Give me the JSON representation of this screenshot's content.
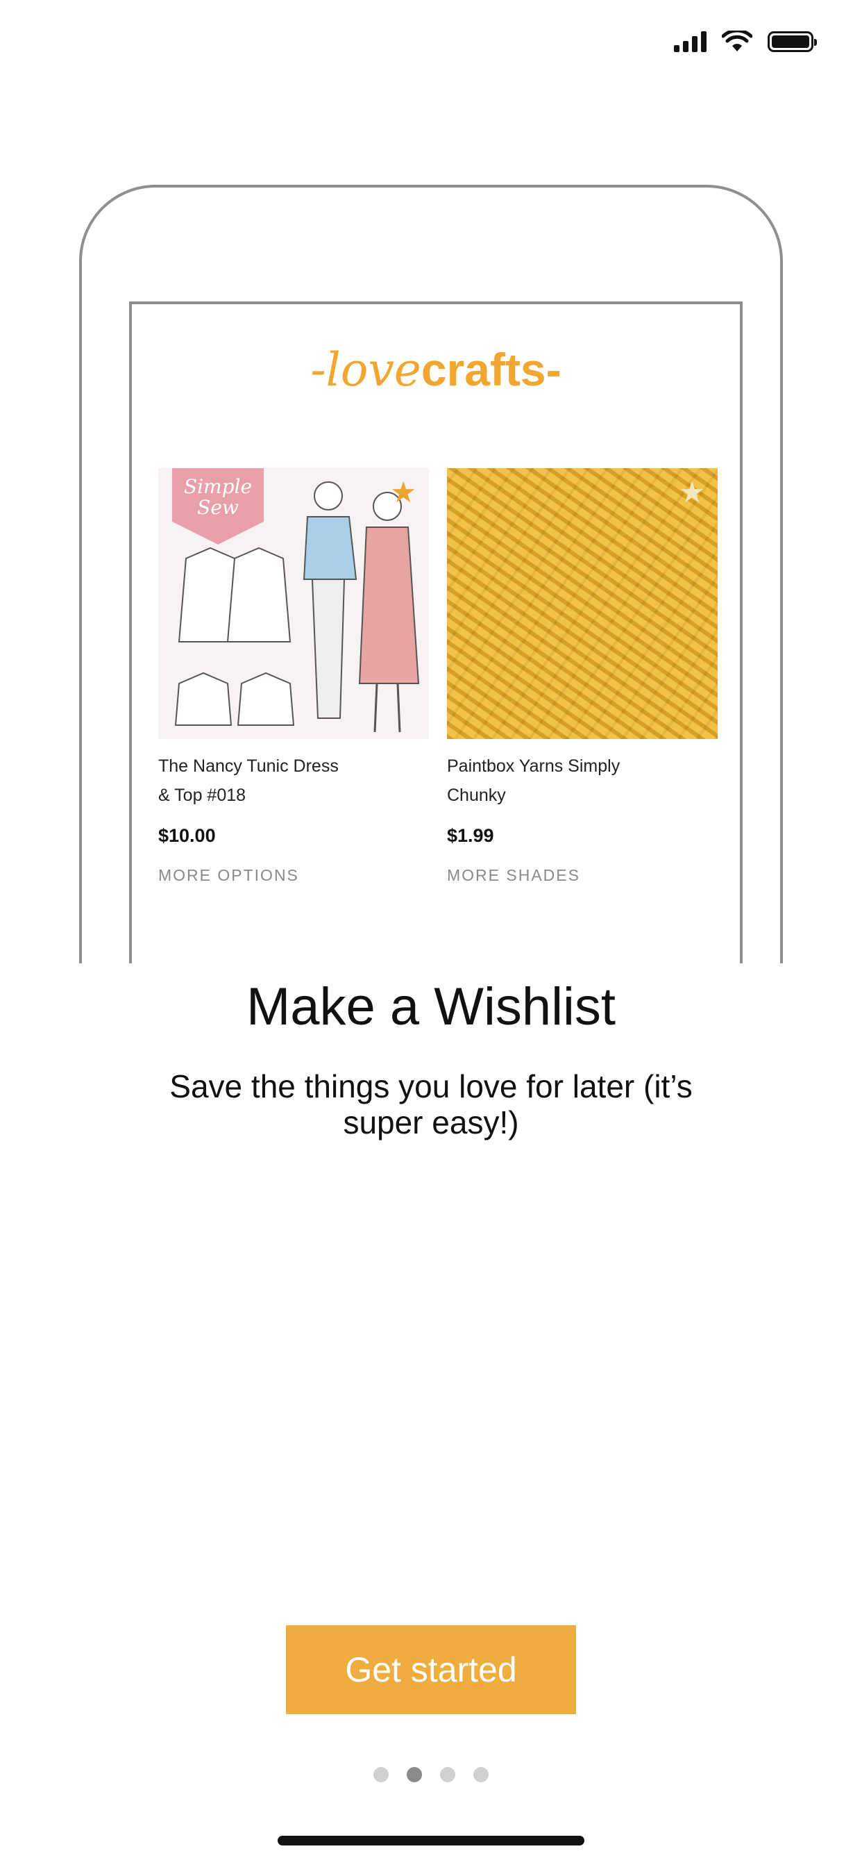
{
  "status_bar": {
    "icons": [
      "signal-icon",
      "wifi-icon",
      "battery-icon"
    ]
  },
  "illustration": {
    "logo": {
      "part1": "-love",
      "part2": "crafts-",
      "color": "#f0a630"
    },
    "products": [
      {
        "title_line1": "The Nancy Tunic Dress",
        "title_line2": "& Top #018",
        "price": "$10.00",
        "link": "MORE OPTIONS",
        "tag": "Simple Sew",
        "star": "star-icon"
      },
      {
        "title_line1": "Paintbox Yarns Simply",
        "title_line2": "Chunky",
        "price": "$1.99",
        "link": "MORE SHADES",
        "star": "star-icon"
      }
    ]
  },
  "onboarding": {
    "title": "Make a Wishlist",
    "subtitle": "Save the things you love for later (it’s super easy!)",
    "cta": "Get started",
    "pages": 4,
    "current_page": 2
  },
  "colors": {
    "accent": "#f0ad3f",
    "yarn": "#eab532",
    "dot_active": "#8a8a8a",
    "dot_inactive": "#d1d1d1"
  }
}
